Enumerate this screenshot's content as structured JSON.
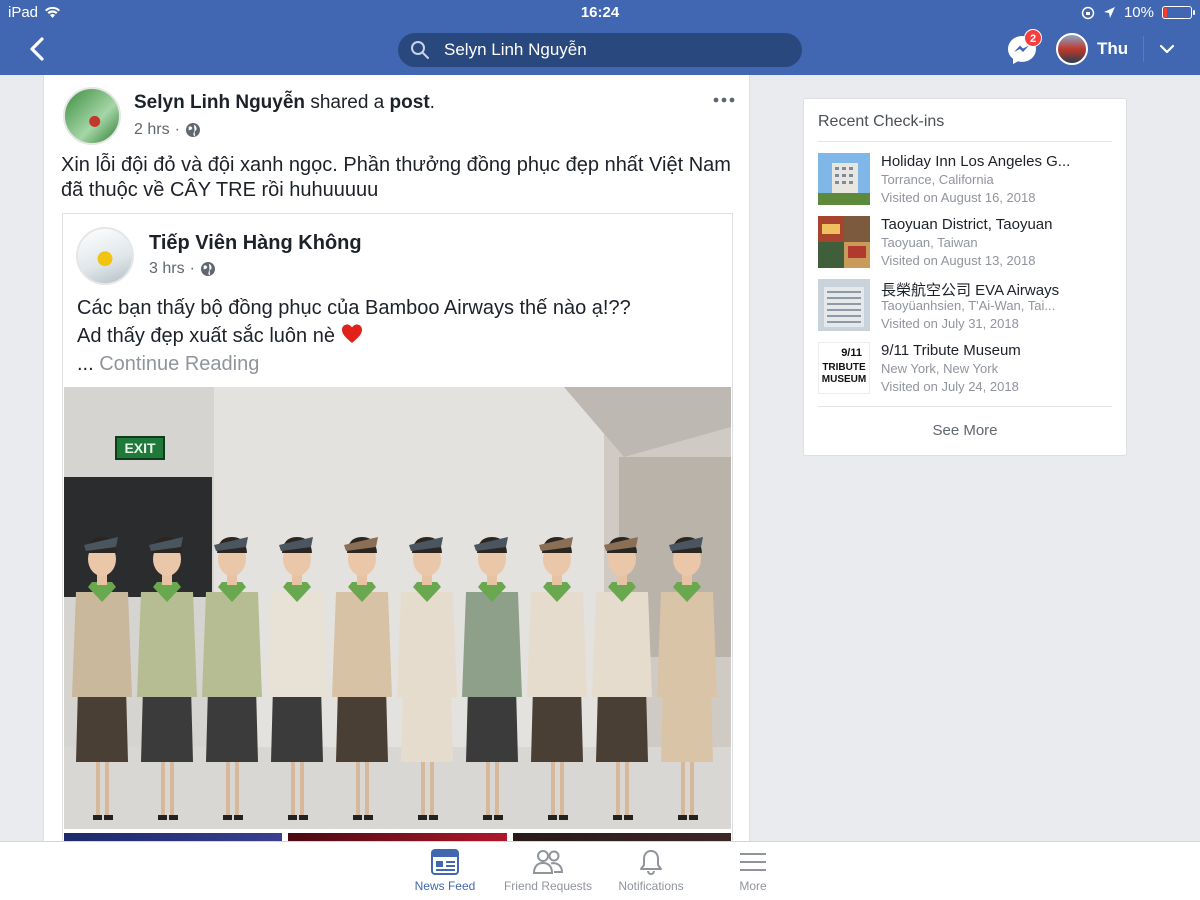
{
  "status_bar": {
    "carrier": "iPad",
    "time": "16:24",
    "battery": "10%",
    "battery_level": 0.1
  },
  "nav": {
    "search_text": "Selyn Linh Nguyễn",
    "messenger_badge": "2",
    "user_name": "Thu"
  },
  "post": {
    "author": "Selyn Linh Nguyễn",
    "action_prefix": "shared a",
    "action_object": "post",
    "action_suffix": ".",
    "time": "2 hrs",
    "text": "Xin lỗi đội đỏ và đội xanh ngọc. Phần thưởng đồng phục đẹp nhất Việt Nam đã thuộc về CÂY TRE rồi huhuuuuu",
    "shared": {
      "author": "Tiếp Viên Hàng Không",
      "time": "3 hrs",
      "line1": "Các bạn thấy bộ đồng phục của Bamboo Airways thế nào ạ!??",
      "line2": "Ad thấy đẹp xuất sắc luôn nè",
      "ellipsis": "...",
      "continue": "Continue Reading",
      "photo_sign": "EXIT"
    }
  },
  "checkins": {
    "title": "Recent Check-ins",
    "items": [
      {
        "name": "Holiday Inn Los Angeles G...",
        "location": "Torrance, California",
        "visited": "Visited on August 16, 2018"
      },
      {
        "name": "Taoyuan District, Taoyuan",
        "location": "Taoyuan, Taiwan",
        "visited": "Visited on August 13, 2018"
      },
      {
        "name": "長榮航空公司 EVA Airways",
        "location": "Taoyüanhsien, T'Ai-Wan, Tai...",
        "visited": "Visited on July 31, 2018"
      },
      {
        "name": "9/11 Tribute Museum",
        "location": "New York, New York",
        "visited": "Visited on July 24, 2018",
        "thumb_text": [
          "9/11",
          "TRIBUTE",
          "MUSEUM"
        ]
      }
    ],
    "see_more": "See More"
  },
  "tabs": [
    {
      "label": "News Feed",
      "icon": "news-feed-icon",
      "active": true
    },
    {
      "label": "Friend Requests",
      "icon": "friend-requests-icon",
      "active": false
    },
    {
      "label": "Notifications",
      "icon": "bell-icon",
      "active": false
    },
    {
      "label": "More",
      "icon": "hamburger-icon",
      "active": false
    }
  ],
  "colors": {
    "brand": "#4267b2",
    "search_bg": "#29487d",
    "badge": "#fa3e3e",
    "page_bg": "#e9ebee"
  }
}
